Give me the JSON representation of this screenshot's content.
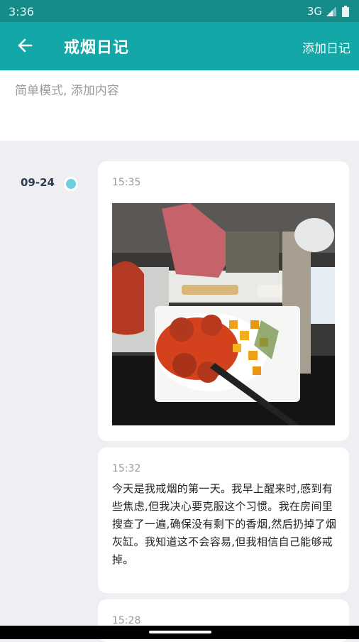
{
  "status": {
    "time": "3:36",
    "network": "3G"
  },
  "app_bar": {
    "title": "戒烟日记",
    "add_label": "添加日记"
  },
  "input": {
    "placeholder": "简单模式, 添加内容"
  },
  "timeline": {
    "date": "09-24",
    "entries": [
      {
        "time": "15:35",
        "type": "photo"
      },
      {
        "time": "15:32",
        "type": "text",
        "text": "今天是我戒烟的第一天。我早上醒来时,感到有些焦虑,但我决心要克服这个习惯。我在房间里搜查了一遍,确保没有剩下的香烟,然后扔掉了烟灰缸。我知道这不会容易,但我相信自己能够戒掉。"
      },
      {
        "time": "15:28",
        "type": "text",
        "text": ""
      }
    ]
  }
}
